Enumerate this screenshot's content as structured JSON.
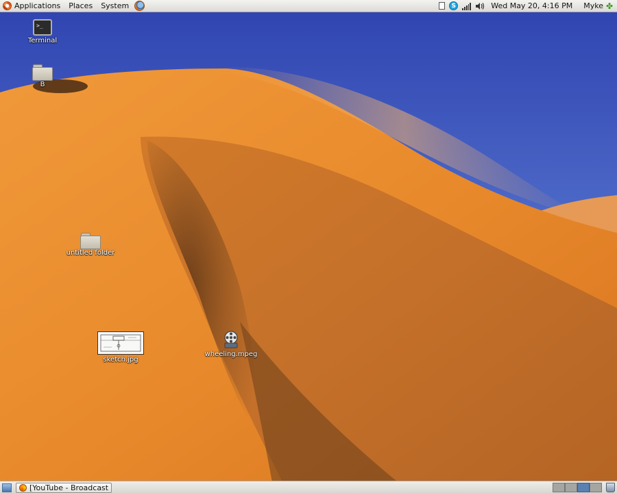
{
  "top_panel": {
    "menus": [
      "Applications",
      "Places",
      "System"
    ],
    "clock": "Wed May 20,  4:16 PM",
    "user": "Myke",
    "icons": {
      "ubuntu": "ubuntu-logo-icon",
      "firefox": "firefox-icon",
      "tray": [
        "document-icon",
        "skype-icon",
        "network-signal-icon",
        "volume-icon"
      ],
      "user": "user-status-icon"
    }
  },
  "desktop": {
    "icons": [
      {
        "label": "Terminal",
        "icon": "terminal-icon"
      },
      {
        "label": "B",
        "icon": "folder-icon"
      },
      {
        "label": "untitled folder",
        "icon": "folder-icon"
      },
      {
        "label": "sketch.jpg",
        "icon": "image-thumbnail-icon"
      },
      {
        "label": "wheeling.mpeg",
        "icon": "video-file-icon"
      }
    ]
  },
  "bottom_panel": {
    "task": "[YouTube - Broadcast Y...",
    "workspaces": 4,
    "active_workspace": 3
  },
  "colors": {
    "sky": "#4a62c0",
    "dune": "#e98a2e",
    "panel": "#e6e4df",
    "active_workspace": "#5b80b2"
  }
}
